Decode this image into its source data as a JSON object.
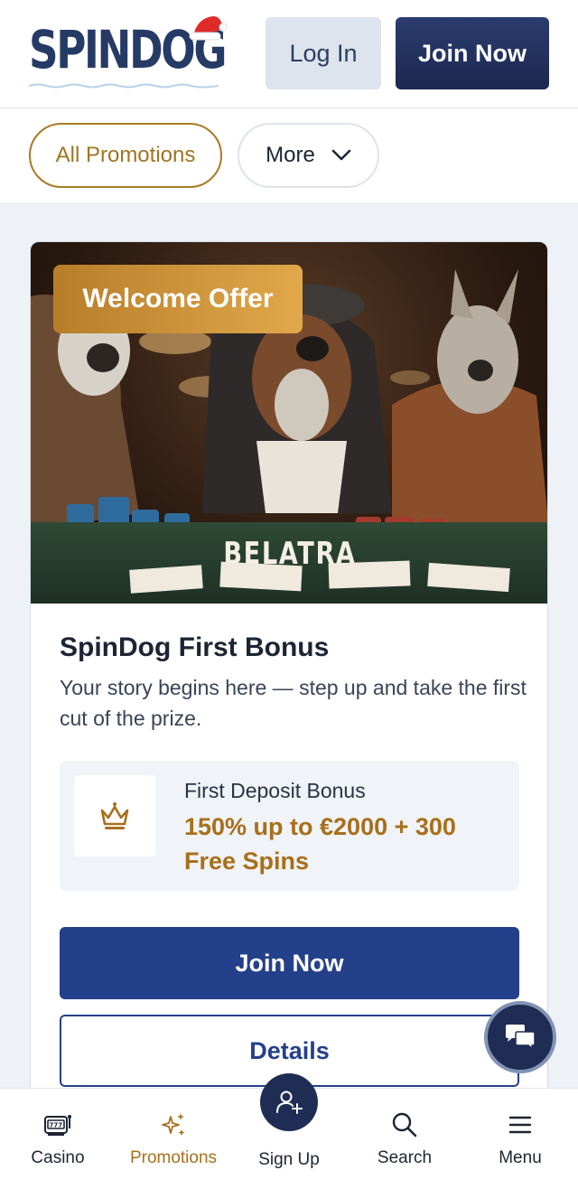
{
  "header": {
    "logo_text": "SPINDOG",
    "login_label": "Log In",
    "join_label": "Join Now"
  },
  "filters": {
    "all_label": "All Promotions",
    "more_label": "More"
  },
  "card": {
    "badge": "Welcome Offer",
    "banner_brand": "BELATRA",
    "title": "SpinDog First Bonus",
    "description": "Your story begins here — step up and take the first cut of the prize.",
    "bonus_label": "First Deposit Bonus",
    "bonus_value": "150% up to €2000 + 300 Free Spins",
    "join_label": "Join Now",
    "details_label": "Details"
  },
  "bottom_nav": {
    "items": [
      {
        "label": "Casino",
        "icon": "slot-machine-icon"
      },
      {
        "label": "Promotions",
        "icon": "sparkles-icon",
        "active": true
      },
      {
        "label": "Sign Up",
        "icon": "add-user-icon"
      },
      {
        "label": "Search",
        "icon": "search-icon"
      },
      {
        "label": "Menu",
        "icon": "hamburger-menu-icon"
      }
    ]
  },
  "colors": {
    "brand_navy": "#1f2d55",
    "primary_blue": "#25408a",
    "gold": "#a86f1c",
    "background": "#eef2f7"
  }
}
